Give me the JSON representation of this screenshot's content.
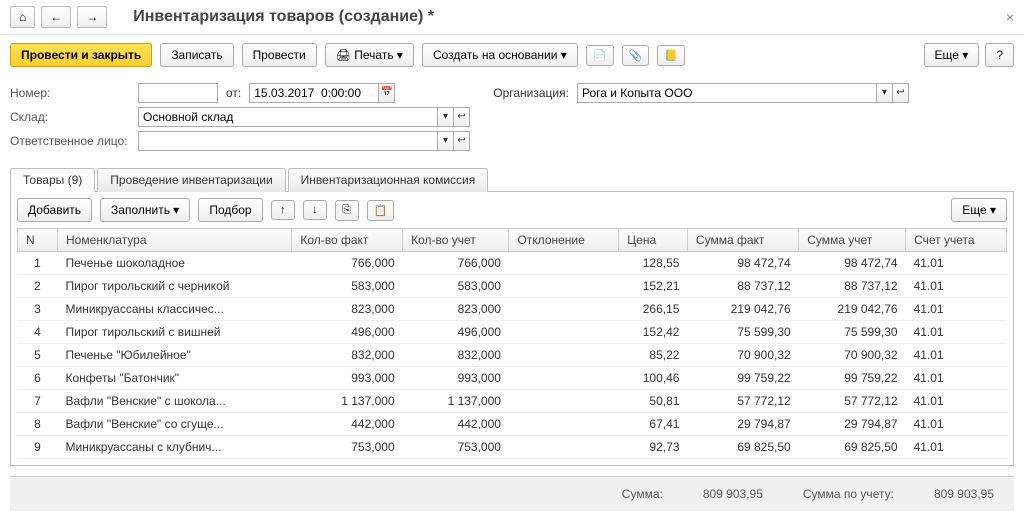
{
  "nav": {
    "home": "⌂",
    "back": "←",
    "fwd": "→"
  },
  "title": "Инвентаризация товаров (создание) *",
  "toolbar": {
    "postClose": "Провести и закрыть",
    "write": "Записать",
    "post": "Провести",
    "print": "Печать ▾",
    "createOn": "Создать на основании ▾",
    "more": "Еще ▾",
    "help": "?"
  },
  "form": {
    "numberLabel": "Номер:",
    "numberVal": "",
    "fromLabel": "от:",
    "date": "15.03.2017  0:00:00",
    "orgLabel": "Организация:",
    "org": "Рога и Копыта ООО",
    "whLabel": "Склад:",
    "wh": "Основной склад",
    "respLabel": "Ответственное лицо:",
    "resp": ""
  },
  "tabs": {
    "t1": "Товары (9)",
    "t2": "Проведение инвентаризации",
    "t3": "Инвентаризационная комиссия"
  },
  "tbl": {
    "add": "Добавить",
    "fill": "Заполнить ▾",
    "pick": "Подбор",
    "more": "Еще ▾",
    "headers": {
      "n": "N",
      "name": "Номенклатура",
      "qf": "Кол-во факт",
      "qa": "Кол-во учет",
      "dev": "Отклонение",
      "price": "Цена",
      "sf": "Сумма факт",
      "sa": "Сумма учет",
      "acc": "Счет учета"
    }
  },
  "rows": [
    {
      "n": 1,
      "name": "Печенье шоколадное",
      "qf": "766,000",
      "qa": "766,000",
      "dev": "",
      "price": "128,55",
      "sf": "98 472,74",
      "sa": "98 472,74",
      "acc": "41.01"
    },
    {
      "n": 2,
      "name": "Пирог тирольский с черникой",
      "qf": "583,000",
      "qa": "583,000",
      "dev": "",
      "price": "152,21",
      "sf": "88 737,12",
      "sa": "88 737,12",
      "acc": "41.01"
    },
    {
      "n": 3,
      "name": "Миникруассаны классичес...",
      "qf": "823,000",
      "qa": "823,000",
      "dev": "",
      "price": "266,15",
      "sf": "219 042,76",
      "sa": "219 042,76",
      "acc": "41.01"
    },
    {
      "n": 4,
      "name": "Пирог тирольский с вишней",
      "qf": "496,000",
      "qa": "496,000",
      "dev": "",
      "price": "152,42",
      "sf": "75 599,30",
      "sa": "75 599,30",
      "acc": "41.01"
    },
    {
      "n": 5,
      "name": "Печенье \"Юбилейное\"",
      "qf": "832,000",
      "qa": "832,000",
      "dev": "",
      "price": "85,22",
      "sf": "70 900,32",
      "sa": "70 900,32",
      "acc": "41.01"
    },
    {
      "n": 6,
      "name": "Конфеты \"Батончик\"",
      "qf": "993,000",
      "qa": "993,000",
      "dev": "",
      "price": "100,46",
      "sf": "99 759,22",
      "sa": "99 759,22",
      "acc": "41.01"
    },
    {
      "n": 7,
      "name": "Вафли \"Венские\" с шокола...",
      "qf": "1 137,000",
      "qa": "1 137,000",
      "dev": "",
      "price": "50,81",
      "sf": "57 772,12",
      "sa": "57 772,12",
      "acc": "41.01"
    },
    {
      "n": 8,
      "name": "Вафли \"Венские\" со сгуще...",
      "qf": "442,000",
      "qa": "442,000",
      "dev": "",
      "price": "67,41",
      "sf": "29 794,87",
      "sa": "29 794,87",
      "acc": "41.01"
    },
    {
      "n": 9,
      "name": "Миникруассаны с клубнич...",
      "qf": "753,000",
      "qa": "753,000",
      "dev": "",
      "price": "92,73",
      "sf": "69 825,50",
      "sa": "69 825,50",
      "acc": "41.01"
    }
  ],
  "footer": {
    "sumLabel": "Сумма:",
    "sum": "809 903,95",
    "sumAccLabel": "Сумма по учету:",
    "sumAcc": "809 903,95"
  }
}
